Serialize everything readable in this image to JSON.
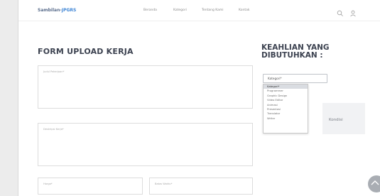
{
  "nav": {
    "brand_prefix": "Sambilan-",
    "brand_accent": "JPGRS",
    "items": [
      "Beranda",
      "Kategori",
      "Tentang Kami",
      "Kontak"
    ]
  },
  "form": {
    "title": "FORM UPLOAD KERJA",
    "fields": {
      "title_placeholder": "Judul Pekerjaan*",
      "description_placeholder": "Deskripsi Kerja*",
      "price_placeholder": "Harga*",
      "deadline_placeholder": "Batas Waktu*"
    }
  },
  "skills": {
    "title": "KEAHLIAN YANG DIBUTUHKAN :",
    "select_value": "Kategori*",
    "options": [
      "Kategori*",
      "Programmer",
      "Graphic Design",
      "Video Editor",
      "Animasi",
      "Presentasi",
      "Translator",
      "Writer"
    ],
    "selected_index": 0,
    "panel_text": "Kondisi"
  },
  "colors": {
    "accent": "#3f86d6",
    "heading": "#3c4250"
  },
  "icons": {
    "search": "search-icon",
    "user": "user-icon",
    "fab": "chevron-up-icon"
  }
}
